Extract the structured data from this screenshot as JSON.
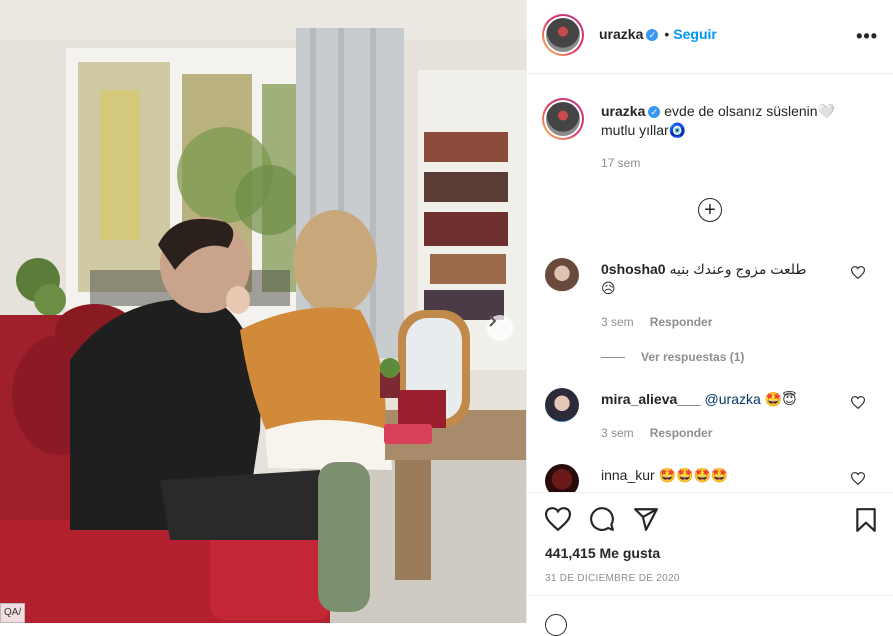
{
  "post": {
    "username": "urazka",
    "follow_label": "Seguir",
    "dot": "•",
    "more_label": "•••",
    "caption": "evde de olsanız süslenin🤍 mutlu yıllar🧿",
    "caption_time": "17 sem",
    "likes": "441,415 Me gusta",
    "date": "31 DE DICIEMBRE DE 2020"
  },
  "comments": [
    {
      "username": "0shosha0",
      "text": "طلعت مزوج وعندك بنيه",
      "emoji": "😥",
      "time": "3 sem",
      "reply_label": "Responder",
      "view_replies": "Ver respuestas (1)"
    },
    {
      "username": "mira_alieva___",
      "mention": "@urazka",
      "emoji": "🤩😇",
      "time": "3 sem",
      "reply_label": "Responder"
    },
    {
      "username": "inna_kur",
      "emoji": "🤩🤩🤩🤩"
    }
  ],
  "icons": {
    "like": "heart-icon",
    "comment": "comment-icon",
    "share": "paper-plane-icon",
    "save": "bookmark-icon",
    "add": "plus-circle-icon",
    "verified": "verified-badge-icon",
    "next": "chevron-right-icon"
  },
  "colors": {
    "accent": "#0095f6",
    "verified": "#3897f0",
    "muted": "#8e8e8e",
    "text": "#262626"
  },
  "watermark": "QA/"
}
